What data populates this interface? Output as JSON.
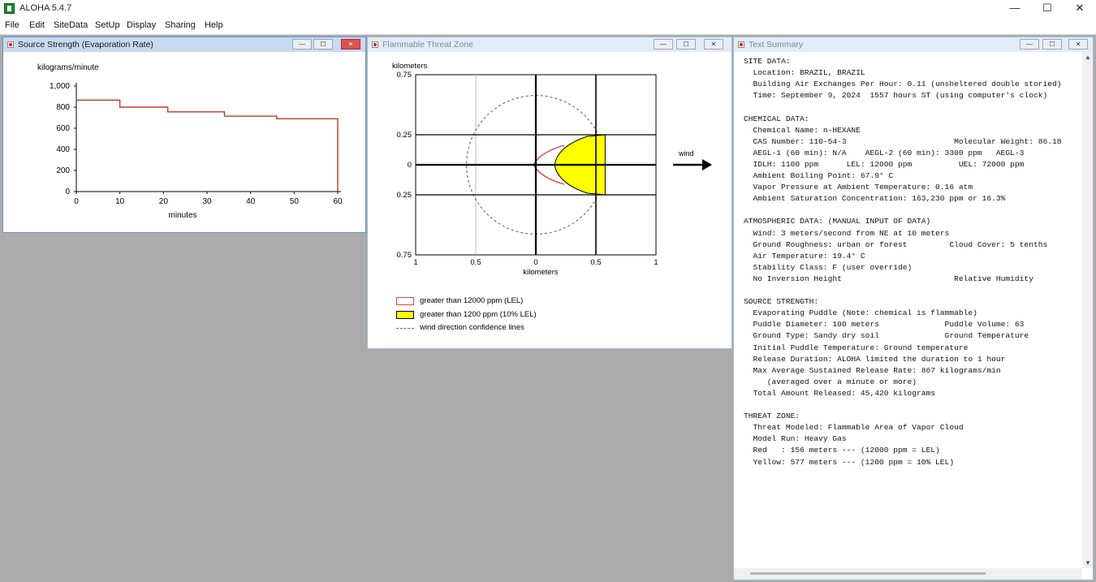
{
  "app": {
    "title": "ALOHA 5.4.7"
  },
  "window_controls": {
    "minimize": "—",
    "maximize": "☐",
    "close": "✕"
  },
  "menu": [
    "File",
    "Edit",
    "SiteData",
    "SetUp",
    "Display",
    "Sharing",
    "Help"
  ],
  "windows": {
    "source": {
      "title": "Source Strength (Evaporation Rate)",
      "buttons": {
        "min": "—",
        "max": "☐",
        "close": "✕"
      }
    },
    "threat": {
      "title": "Flammable Threat Zone",
      "buttons": {
        "min": "—",
        "max": "☐",
        "close": "✕"
      },
      "wind_label": "wind",
      "legend": [
        {
          "label": "greater than 12000 ppm (LEL)",
          "swatch": "#ffffff",
          "border": "#d64545"
        },
        {
          "label": "greater than 1200 ppm (10% LEL)",
          "swatch": "#ffff00",
          "border": "#000000"
        },
        {
          "label": "wind direction confidence lines",
          "swatch": "dash"
        }
      ]
    },
    "text": {
      "title": "Text Summary",
      "buttons": {
        "min": "—",
        "max": "☐",
        "close": "✕"
      },
      "lines": [
        "SITE DATA:",
        "  Location: BRAZIL, BRAZIL",
        "  Building Air Exchanges Per Hour: 0.11 (unsheltered double storied)",
        "  Time: September 9, 2024  1557 hours ST (using computer's clock)",
        "",
        "CHEMICAL DATA:",
        "  Chemical Name: n-HEXANE",
        "  CAS Number: 110-54-3                       Molecular Weight: 86.18",
        "  AEGL-1 (60 min): N/A    AEGL-2 (60 min): 3300 ppm   AEGL-3",
        "  IDLH: 1100 ppm      LEL: 12000 ppm          UEL: 72000 ppm",
        "  Ambient Boiling Point: 67.9° C",
        "  Vapor Pressure at Ambient Temperature: 0.16 atm",
        "  Ambient Saturation Concentration: 163,230 ppm or 16.3%",
        "",
        "ATMOSPHERIC DATA: (MANUAL INPUT OF DATA)",
        "  Wind: 3 meters/second from NE at 10 meters",
        "  Ground Roughness: urban or forest         Cloud Cover: 5 tenths",
        "  Air Temperature: 19.4° C",
        "  Stability Class: F (user override)",
        "  No Inversion Height                        Relative Humidity",
        "",
        "SOURCE STRENGTH:",
        "  Evaporating Puddle (Note: chemical is flammable)",
        "  Puddle Diameter: 100 meters              Puddle Volume: 63",
        "  Ground Type: Sandy dry soil              Ground Temperature",
        "  Initial Puddle Temperature: Ground temperature",
        "  Release Duration: ALOHA limited the duration to 1 hour",
        "  Max Average Sustained Release Rate: 867 kilograms/min",
        "     (averaged over a minute or more)",
        "  Total Amount Released: 45,420 kilograms",
        "",
        "THREAT ZONE:",
        "  Threat Modeled: Flammable Area of Vapor Cloud",
        "  Model Run: Heavy Gas",
        "  Red   : 156 meters --- (12000 ppm = LEL)",
        "  Yellow: 577 meters --- (1200 ppm = 10% LEL)"
      ]
    }
  },
  "chart_data": [
    {
      "type": "line",
      "ylabel": "kilograms/minute",
      "xlabel": "minutes",
      "xlim": [
        0,
        60
      ],
      "ylim": [
        0,
        1000
      ],
      "xticks": [
        "0",
        "10",
        "20",
        "30",
        "40",
        "50",
        "60"
      ],
      "yticks": [
        "1,000",
        "800",
        "600",
        "400",
        "200",
        "0"
      ],
      "series": [
        {
          "points": [
            [
              0,
              867
            ],
            [
              10,
              867
            ],
            [
              10,
              800
            ],
            [
              21,
              800
            ],
            [
              21,
              755
            ],
            [
              34,
              755
            ],
            [
              34,
              715
            ],
            [
              46,
              715
            ],
            [
              46,
              690
            ],
            [
              60,
              690
            ],
            [
              60,
              0
            ]
          ],
          "color": "#c0392b"
        }
      ],
      "grid": false
    },
    {
      "type": "area",
      "ylabel": "kilometers",
      "xlabel": "kilometers",
      "xlim": [
        -1,
        1
      ],
      "ylim": [
        -0.75,
        0.75
      ],
      "xticks": [
        "1",
        "0.5",
        "0",
        "0.5",
        "1"
      ],
      "yticks": [
        "0.75",
        "0.25",
        "0",
        "0.25",
        "0.75"
      ],
      "zones": [
        {
          "name": "red",
          "threshold": "12000 ppm (LEL)",
          "extent_km": 0.156,
          "color": "#d64545"
        },
        {
          "name": "yellow",
          "threshold": "1200 ppm (10% LEL)",
          "extent_km": 0.577,
          "color": "#ffff00"
        }
      ],
      "grid": true
    }
  ]
}
